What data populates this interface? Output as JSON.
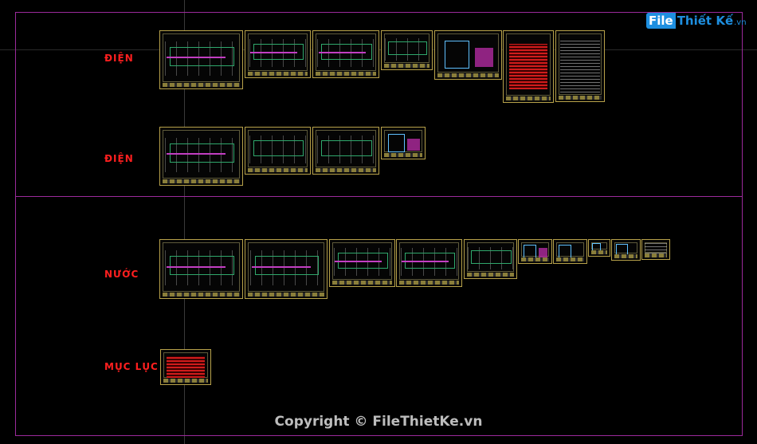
{
  "logo": {
    "brand_prefix": "File",
    "brand_main": "Thiết Kế",
    "brand_suffix": ".vn"
  },
  "sections": [
    {
      "label": "ĐIỆN"
    },
    {
      "label": "ĐIỆN"
    },
    {
      "label": "NƯỚC"
    },
    {
      "label": "MỤC LỤC"
    }
  ],
  "watermark": "Copyright © FileThietKe.vn",
  "colors": {
    "frame": "#9b2a9b",
    "label": "#ff1f1f",
    "sheet_border": "#b8a24a",
    "brand": "#1e8fe0"
  }
}
